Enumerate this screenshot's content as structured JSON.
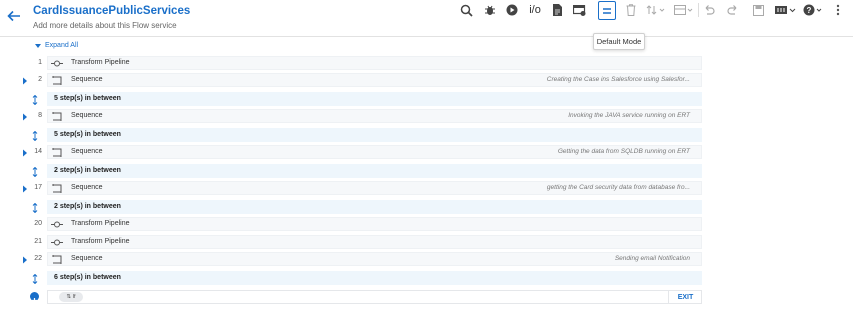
{
  "header": {
    "title": "CardIssuancePublicServices",
    "subtitle": "Add more details about this Flow service"
  },
  "toolbar": {
    "io_label": "i/o",
    "tooltip": "Default Mode",
    "icons": [
      "search-icon",
      "debug-icon",
      "run-icon",
      "io-button",
      "document-icon",
      "schedule-icon",
      "default-mode-icon",
      "delete-icon",
      "sort-icon",
      "layout-icon",
      "undo-icon",
      "redo-icon",
      "save-icon",
      "version-icon",
      "help-icon",
      "more-icon"
    ]
  },
  "expand_all": "Expand All",
  "steps": [
    {
      "num": "1",
      "type": "Transform Pipeline",
      "comment": "",
      "expandable": false,
      "icon": "transform"
    },
    {
      "num": "2",
      "type": "Sequence",
      "comment": "Creating the Case ins Salesforce using Salesfor...",
      "expandable": true,
      "icon": "sequence"
    },
    {
      "between": "5 step(s) in between"
    },
    {
      "num": "8",
      "type": "Sequence",
      "comment": "Invoking the JAVA service running on ERT",
      "expandable": true,
      "icon": "sequence"
    },
    {
      "between": "5 step(s) in between"
    },
    {
      "num": "14",
      "type": "Sequence",
      "comment": "Getting the data from SQLDB running on ERT",
      "expandable": true,
      "icon": "sequence"
    },
    {
      "between": "2 step(s) in between"
    },
    {
      "num": "17",
      "type": "Sequence",
      "comment": "getting the Card security data from database fro...",
      "expandable": true,
      "icon": "sequence"
    },
    {
      "between": "2 step(s) in between"
    },
    {
      "num": "20",
      "type": "Transform Pipeline",
      "comment": "",
      "expandable": false,
      "icon": "transform"
    },
    {
      "num": "21",
      "type": "Transform Pipeline",
      "comment": "",
      "expandable": false,
      "icon": "transform"
    },
    {
      "num": "22",
      "type": "Sequence",
      "comment": "Sending email Notification",
      "expandable": true,
      "icon": "sequence"
    },
    {
      "between": "6 step(s) in between"
    }
  ],
  "footer": {
    "pill": "⇅ If",
    "exit": "EXIT"
  },
  "colors": {
    "accent": "#1a6fc9",
    "row_bg": "#f6f8fa",
    "between_bg": "#eef6fc"
  }
}
